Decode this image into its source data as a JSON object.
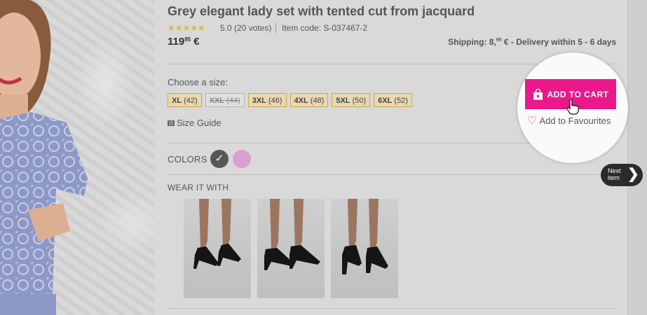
{
  "product": {
    "title": "Grey elegant lady set with tented cut from jacquard",
    "stars": "★★★★★",
    "rating": "5.0 (20 votes)",
    "item_code": "Item code: S-037467-2",
    "price_main": "119",
    "price_cents": "95",
    "price_currency": "€"
  },
  "shipping": {
    "prefix": "Shipping: 8,",
    "cents": "95",
    "suffix": " € - Delivery within 5 - 6 days"
  },
  "sizes": {
    "label": "Choose a size:",
    "options": [
      {
        "code": "XL",
        "eu": "(42)",
        "available": true
      },
      {
        "code": "XXL",
        "eu": "(44)",
        "available": false
      },
      {
        "code": "3XL",
        "eu": "(46)",
        "available": true
      },
      {
        "code": "4XL",
        "eu": "(48)",
        "available": true
      },
      {
        "code": "5XL",
        "eu": "(50)",
        "available": true
      },
      {
        "code": "6XL",
        "eu": "(52)",
        "available": true
      }
    ],
    "guide": "Size Guide"
  },
  "colors": {
    "label": "COLORS",
    "swatches": [
      {
        "name": "grey",
        "hex": "#575757",
        "selected": true,
        "check": "✓"
      },
      {
        "name": "pink",
        "hex": "#dba0cf",
        "selected": false
      }
    ]
  },
  "wear_it_with": {
    "label": "WEAR IT WITH"
  },
  "actions": {
    "add_to_cart": "ADD TO CART",
    "add_to_favourites": "Add to Favourites"
  },
  "next_item": {
    "line1": "Next",
    "line2": "item",
    "chevron": "❯"
  },
  "colors_theme": {
    "accent": "#e9198c",
    "size_bg": "#e7d9b0",
    "size_border": "#d1a84a"
  }
}
